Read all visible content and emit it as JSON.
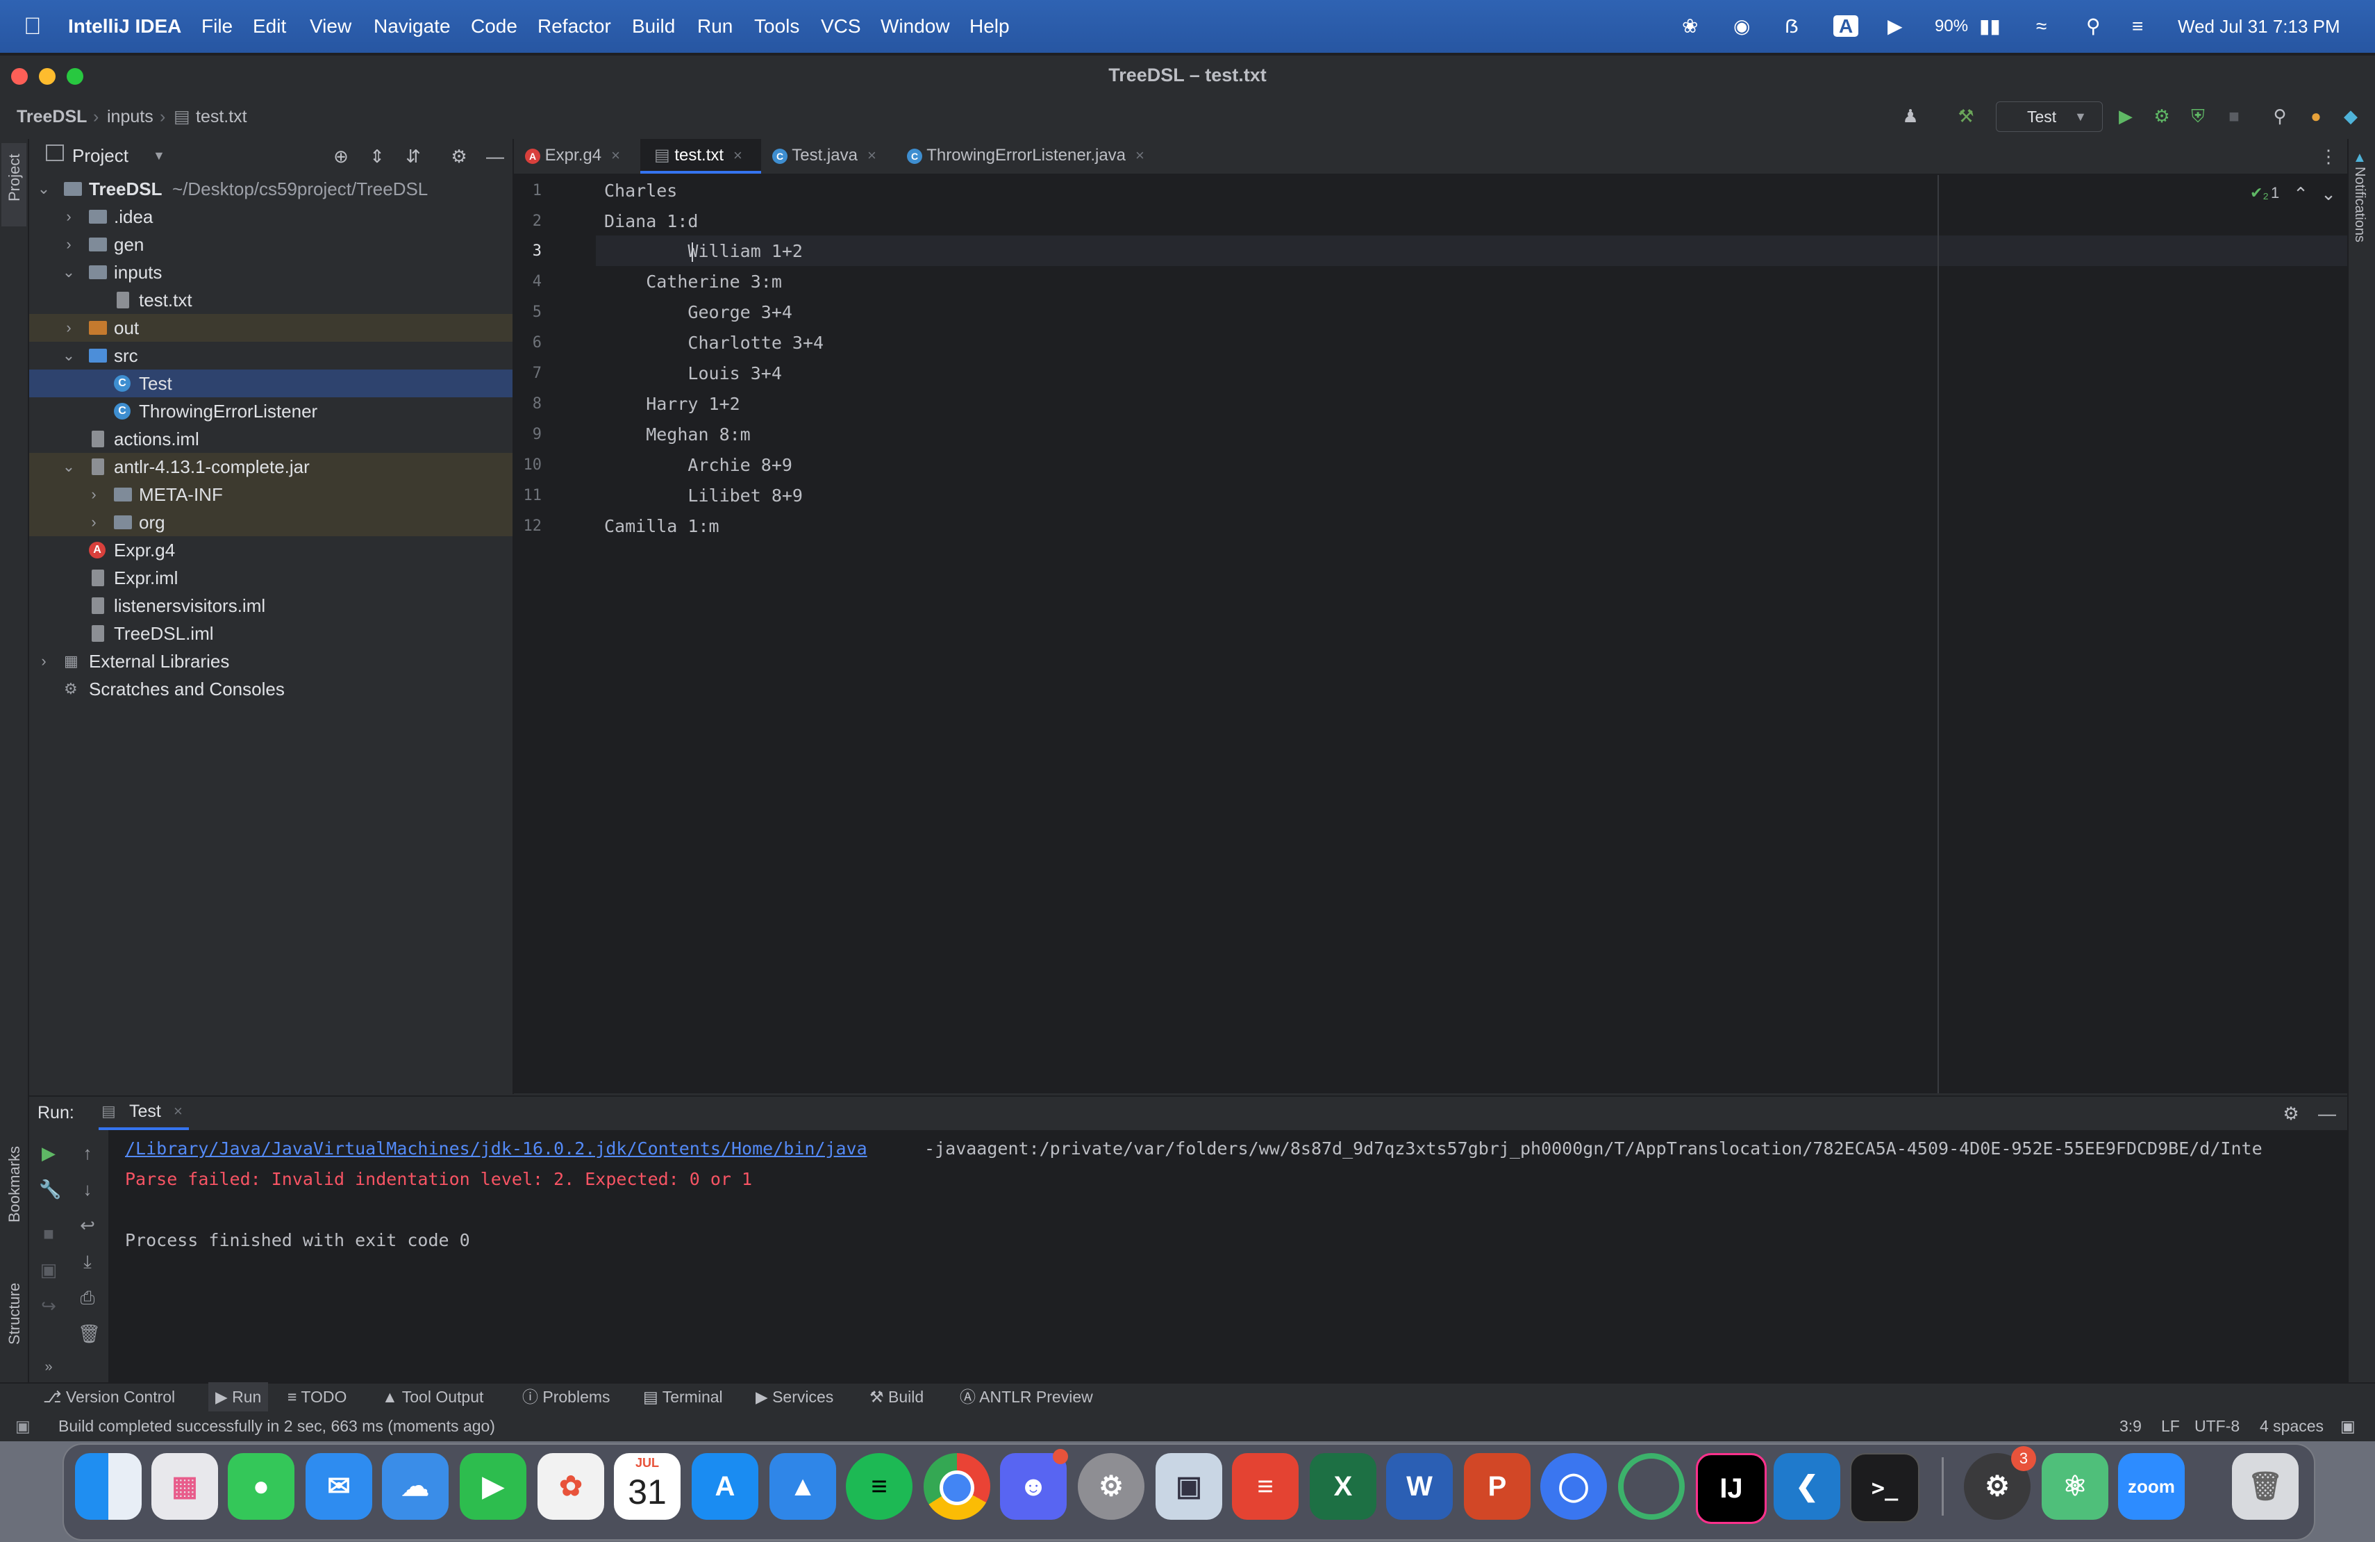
{
  "menubar": {
    "app": "IntelliJ IDEA",
    "items": [
      "File",
      "Edit",
      "View",
      "Navigate",
      "Code",
      "Refactor",
      "Build",
      "Run",
      "Tools",
      "VCS",
      "Window",
      "Help"
    ],
    "battery": "90%",
    "datetime": "Wed Jul 31  7:13 PM"
  },
  "window": {
    "title": "TreeDSL – test.txt"
  },
  "breadcrumb": {
    "project": "TreeDSL",
    "folder": "inputs",
    "file": "test.txt"
  },
  "toolbar": {
    "run_config": "Test"
  },
  "project_panel": {
    "title": "Project",
    "root_name": "TreeDSL",
    "root_path": "~/Desktop/cs59project/TreeDSL",
    "rows": [
      {
        "label": ".idea"
      },
      {
        "label": "gen"
      },
      {
        "label": "inputs"
      },
      {
        "label": "test.txt"
      },
      {
        "label": "out"
      },
      {
        "label": "src"
      },
      {
        "label": "Test"
      },
      {
        "label": "ThrowingErrorListener"
      },
      {
        "label": "actions.iml"
      },
      {
        "label": "antlr-4.13.1-complete.jar"
      },
      {
        "label": "META-INF"
      },
      {
        "label": "org"
      },
      {
        "label": "Expr.g4"
      },
      {
        "label": "Expr.iml"
      },
      {
        "label": "listenersvisitors.iml"
      },
      {
        "label": "TreeDSL.iml"
      },
      {
        "label": "External Libraries"
      },
      {
        "label": "Scratches and Consoles"
      }
    ]
  },
  "tabs": [
    "Expr.g4",
    "test.txt",
    "Test.java",
    "ThrowingErrorListener.java"
  ],
  "editor": {
    "inspection_count": "1",
    "lines": [
      {
        "n": "1",
        "text": "Charles"
      },
      {
        "n": "2",
        "text": "Diana 1:d"
      },
      {
        "n": "3",
        "text": "        William 1+2"
      },
      {
        "n": "4",
        "text": "    Catherine 3:m"
      },
      {
        "n": "5",
        "text": "        George 3+4"
      },
      {
        "n": "6",
        "text": "        Charlotte 3+4"
      },
      {
        "n": "7",
        "text": "        Louis 3+4"
      },
      {
        "n": "8",
        "text": "    Harry 1+2"
      },
      {
        "n": "9",
        "text": "    Meghan 8:m"
      },
      {
        "n": "10",
        "text": "        Archie 8+9"
      },
      {
        "n": "11",
        "text": "        Lilibet 8+9"
      },
      {
        "n": "12",
        "text": "Camilla 1:m"
      }
    ]
  },
  "run_panel": {
    "label": "Run:",
    "tab": "Test",
    "cmd_link": "/Library/Java/JavaVirtualMachines/jdk-16.0.2.jdk/Contents/Home/bin/java",
    "cmd_rest": " -javaagent:/private/var/folders/ww/8s87d_9d7qz3xts57gbrj_ph0000gn/T/AppTranslocation/782ECA5A-4509-4D0E-952E-55EE9FDCD9BE/d/Inte",
    "error": "Parse failed: Invalid indentation level: 2. Expected: 0 or 1",
    "finished": "Process finished with exit code 0"
  },
  "side_labels": {
    "project": "Project",
    "bookmarks": "Bookmarks",
    "structure": "Structure",
    "notifications": "Notifications"
  },
  "bottom_tools": [
    "Version Control",
    "Run",
    "TODO",
    "Tool Output",
    "Problems",
    "Terminal",
    "Services",
    "Build",
    "ANTLR Preview"
  ],
  "status": {
    "message": "Build completed successfully in 2 sec, 663 ms (moments ago)",
    "position": "3:9",
    "line_sep": "LF",
    "encoding": "UTF-8",
    "indent": "4 spaces"
  },
  "dock": {
    "calendar_month": "JUL",
    "calendar_day": "31",
    "badge_count": "3"
  },
  "colors": {
    "accent": "#3574f0",
    "error": "#f75464",
    "link": "#548af7",
    "selection": "#2e436e"
  }
}
